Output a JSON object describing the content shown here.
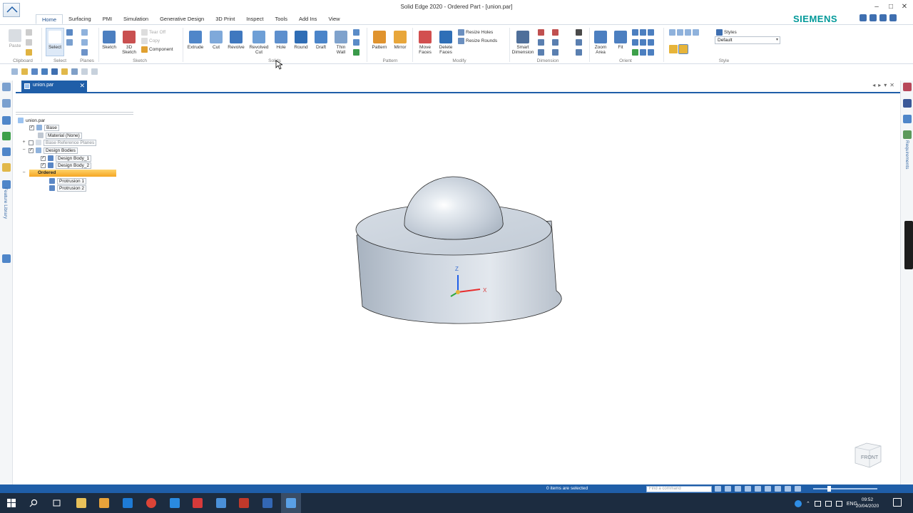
{
  "window": {
    "title": "Solid Edge 2020 - Ordered Part - [union.par]",
    "controls": [
      "–",
      "□",
      "✕"
    ]
  },
  "ribbon": {
    "tabs": [
      "Home",
      "Surfacing",
      "PMI",
      "Simulation",
      "Generative Design",
      "3D Print",
      "Inspect",
      "Tools",
      "Add Ins",
      "View"
    ],
    "active_tab": "Home",
    "brand": "SIEMENS",
    "groups": {
      "clipboard": {
        "label": "Clipboard",
        "paste": "Paste"
      },
      "select": {
        "label": "Select",
        "select": "Select"
      },
      "planes": {
        "label": "Planes"
      },
      "sketch": {
        "label": "Sketch",
        "sketch": "Sketch",
        "sketch3d_line1": "3D",
        "sketch3d_line2": "Sketch",
        "tear_off": "Tear Off",
        "copy": "Copy",
        "component": "Component"
      },
      "solids": {
        "label": "Solids",
        "extrude": "Extrude",
        "cut": "Cut",
        "revolve": "Revolve",
        "revolved_cut_line1": "Revolved",
        "revolved_cut_line2": "Cut",
        "hole": "Hole",
        "round": "Round",
        "draft": "Draft",
        "thin_wall_line1": "Thin",
        "thin_wall_line2": "Wall"
      },
      "pattern": {
        "label": "Pattern",
        "pattern": "Pattern",
        "mirror": "Mirror"
      },
      "modify": {
        "label": "Modify",
        "move_faces_line1": "Move",
        "move_faces_line2": "Faces",
        "delete_faces_line1": "Delete",
        "delete_faces_line2": "Faces",
        "resize_holes": "Resize Holes",
        "resize_rounds": "Resize Rounds"
      },
      "dimension": {
        "label": "Dimension",
        "smart_dimension_line1": "Smart",
        "smart_dimension_line2": "Dimension"
      },
      "orient": {
        "label": "Orient",
        "zoom_area_line1": "Zoom",
        "zoom_area_line2": "Area",
        "fit": "Fit"
      },
      "style": {
        "label": "Style",
        "styles": "Styles",
        "selected_style": "Default"
      }
    }
  },
  "document": {
    "tab_name": "union.par"
  },
  "tree": {
    "root": "union.par",
    "base": "Base",
    "material": "Material (None)",
    "base_reference_planes": "Base Reference Planes",
    "design_bodies": "Design Bodies",
    "design_body_1": "Design Body_1",
    "design_body_2": "Design Body_2",
    "ordered": "Ordered",
    "protrusion_1": "Protrusion 1",
    "protrusion_2": "Protrusion 2"
  },
  "side_panels": {
    "left_label": "Feature Library",
    "right_label": "Requirements"
  },
  "viewport": {
    "triad": {
      "z": "Z",
      "x": "X"
    },
    "view_cube_face": "FRONT"
  },
  "status": {
    "selection": "0 items are selected",
    "find_placeholder": "Find a command"
  },
  "taskbar": {
    "language": "ENG",
    "time": "09:52",
    "date": "20/04/2020"
  },
  "colors": {
    "accent": "#1f5ea8",
    "brand": "#009999",
    "ordered_highlight": "#f5a623",
    "taskbar": "#1c2c40"
  }
}
